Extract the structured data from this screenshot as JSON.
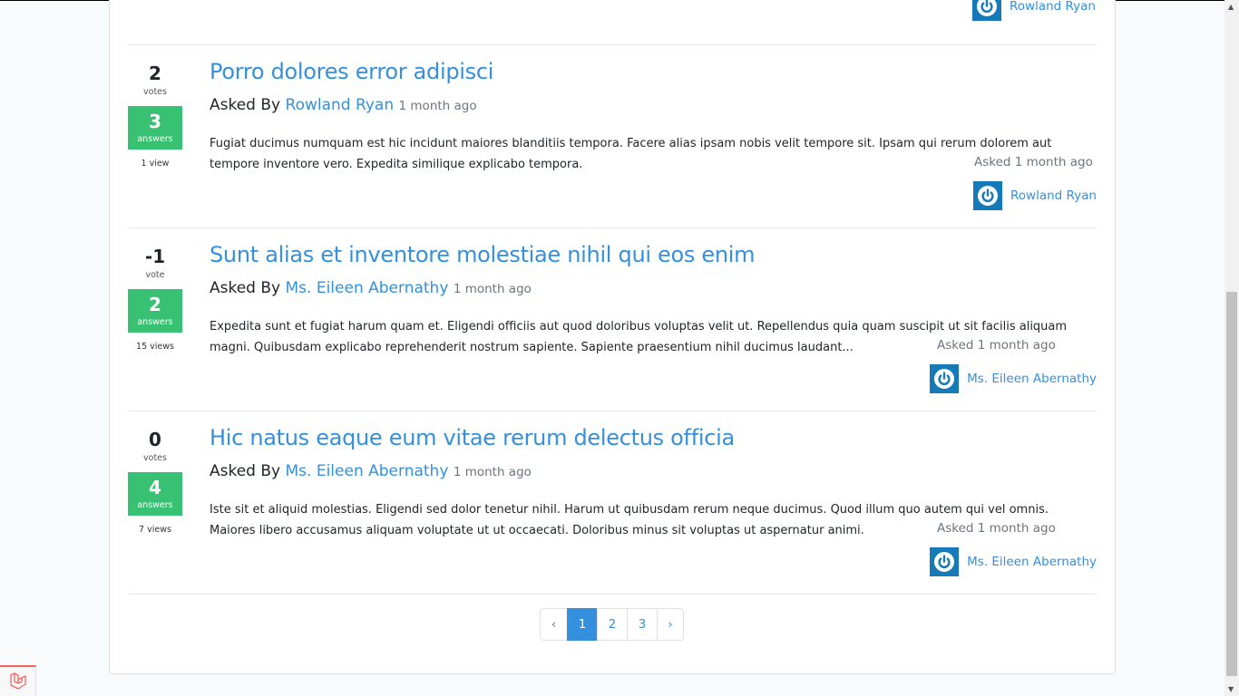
{
  "previous_question": {
    "author": "Rowland Ryan"
  },
  "questions": [
    {
      "votes": "2",
      "votes_label": "votes",
      "answers": "3",
      "answers_label": "answers",
      "views": "1 view",
      "title": "Porro dolores error adipisci",
      "asked_by_prefix": "Asked By",
      "author": "Rowland Ryan",
      "ago": "1 month ago",
      "excerpt": "Fugiat ducimus numquam est hic incidunt maiores blanditiis tempora. Facere alias ipsam nobis velit tempore sit. Ipsam qui rerum dolorem aut tempore inventore vero. Expedita similique explicabo tempora.",
      "asked_meta": "Asked 1 month ago"
    },
    {
      "votes": "-1",
      "votes_label": "vote",
      "answers": "2",
      "answers_label": "answers",
      "views": "15 views",
      "title": "Sunt alias et inventore molestiae nihil qui eos enim",
      "asked_by_prefix": "Asked By",
      "author": "Ms. Eileen Abernathy",
      "ago": "1 month ago",
      "excerpt": "Expedita sunt et fugiat harum quam et. Eligendi officiis aut quod doloribus voluptas velit ut. Repellendus quia quam suscipit ut sit facilis aliquam magni. Quibusdam explicabo reprehenderit nostrum sapiente. Sapiente praesentium nihil ducimus laudant...",
      "asked_meta": "Asked 1 month ago"
    },
    {
      "votes": "0",
      "votes_label": "votes",
      "answers": "4",
      "answers_label": "answers",
      "views": "7 views",
      "title": "Hic natus eaque eum vitae rerum delectus officia",
      "asked_by_prefix": "Asked By",
      "author": "Ms. Eileen Abernathy",
      "ago": "1 month ago",
      "excerpt": "Iste sit et aliquid molestias. Eligendi sed dolor tenetur nihil. Harum ut quibusdam rerum neque ducimus. Quod illum quo autem qui vel omnis. Maiores libero accusamus aliquam voluptate ut ut occaecati. Doloribus minus sit voluptas ut aspernatur animi.",
      "asked_meta": "Asked 1 month ago"
    }
  ],
  "pagination": {
    "prev": "‹",
    "pages": [
      "1",
      "2",
      "3"
    ],
    "active": "1",
    "next": "›"
  },
  "colors": {
    "link": "#3490dc",
    "answered": "#38c172",
    "avatar": "#1679b8"
  },
  "icons": {
    "avatar": "power-icon",
    "debugbar": "laravel-logo-icon"
  }
}
